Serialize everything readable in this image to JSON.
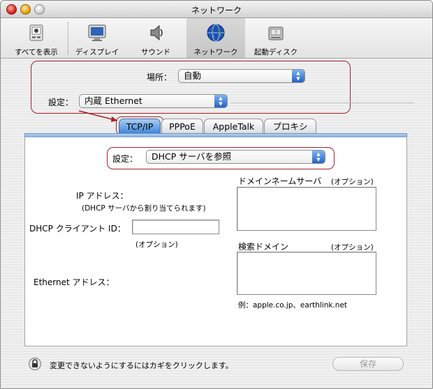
{
  "window": {
    "title": "ネットワーク"
  },
  "toolbar": {
    "items": [
      {
        "label": "すべてを表示",
        "icon": "show-all-icon"
      },
      {
        "label": "ディスプレイ",
        "icon": "display-icon"
      },
      {
        "label": "サウンド",
        "icon": "speaker-icon"
      },
      {
        "label": "ネットワーク",
        "icon": "network-globe-icon",
        "selected": true
      },
      {
        "label": "起動ディスク",
        "icon": "startup-disk-icon"
      }
    ]
  },
  "location": {
    "label": "場所：",
    "value": "自動"
  },
  "configuration": {
    "label": "設定：",
    "value": "内蔵 Ethernet"
  },
  "tabs": [
    "TCP/IP",
    "PPPoE",
    "AppleTalk",
    "プロキシ"
  ],
  "tcpip": {
    "configure_label": "設定：",
    "configure_value": "DHCP サーバを参照",
    "ip_address_label": "IP アドレス：",
    "ip_address_note": "(DHCP サーバから割り当てられます)",
    "dhcp_client_id_label": "DHCP クライアント ID：",
    "dhcp_client_id_value": "",
    "dhcp_client_id_note": "(オプション)",
    "dns_label": "ドメインネームサーバ",
    "dns_optional": "(オプション)",
    "search_domains_label": "検索ドメイン",
    "search_domains_optional": "(オプション)",
    "ethernet_address_label": "Ethernet アドレス：",
    "example": "例：apple.co.jp、earthlink.net"
  },
  "footer": {
    "lock_text": "変更できないようにするにはカギをクリックします。",
    "save_label": "保存"
  },
  "colors": {
    "annotation_red": "#a3222a",
    "aqua_blue": "#3d83d8"
  }
}
